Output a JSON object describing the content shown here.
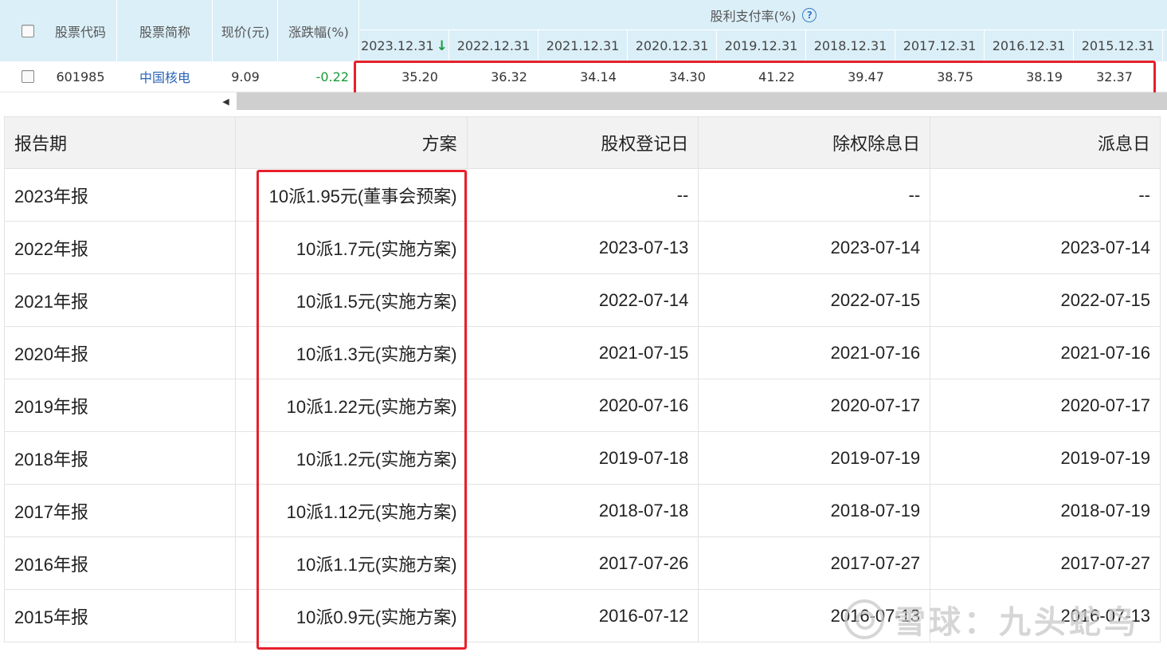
{
  "screener": {
    "headers": {
      "stock_code": "股票代码",
      "stock_name": "股票简称",
      "price": "现价(元)",
      "change_pct": "涨跌幅(%)",
      "payout_group": "股利支付率(%)"
    },
    "years": [
      "2023.12.31",
      "2022.12.31",
      "2021.12.31",
      "2020.12.31",
      "2019.12.31",
      "2018.12.31",
      "2017.12.31",
      "2016.12.31",
      "2015.12.31"
    ],
    "sort_indicator": "↓",
    "help_icon": "?",
    "row": {
      "code": "601985",
      "name": "中国核电",
      "price": "9.09",
      "change": "-0.22",
      "payout": [
        "35.20",
        "36.32",
        "34.14",
        "34.30",
        "41.22",
        "39.47",
        "38.75",
        "38.19",
        "32.37"
      ]
    },
    "scroll_left_icon": "◀",
    "colors": {
      "header_bg": "#dbeff8",
      "link": "#2b63b7",
      "negative": "#1a9a3a",
      "highlight": "#e8202a"
    }
  },
  "dividends": {
    "headers": {
      "period": "报告期",
      "plan": "方案",
      "record_date": "股权登记日",
      "ex_date": "除权除息日",
      "pay_date": "派息日"
    },
    "rows": [
      {
        "period": "2023年报",
        "plan": "10派1.95元(董事会预案)",
        "record": "--",
        "ex": "--",
        "pay": "--"
      },
      {
        "period": "2022年报",
        "plan": "10派1.7元(实施方案)",
        "record": "2023-07-13",
        "ex": "2023-07-14",
        "pay": "2023-07-14"
      },
      {
        "period": "2021年报",
        "plan": "10派1.5元(实施方案)",
        "record": "2022-07-14",
        "ex": "2022-07-15",
        "pay": "2022-07-15"
      },
      {
        "period": "2020年报",
        "plan": "10派1.3元(实施方案)",
        "record": "2021-07-15",
        "ex": "2021-07-16",
        "pay": "2021-07-16"
      },
      {
        "period": "2019年报",
        "plan": "10派1.22元(实施方案)",
        "record": "2020-07-16",
        "ex": "2020-07-17",
        "pay": "2020-07-17"
      },
      {
        "period": "2018年报",
        "plan": "10派1.2元(实施方案)",
        "record": "2019-07-18",
        "ex": "2019-07-19",
        "pay": "2019-07-19"
      },
      {
        "period": "2017年报",
        "plan": "10派1.12元(实施方案)",
        "record": "2018-07-18",
        "ex": "2018-07-19",
        "pay": "2018-07-19"
      },
      {
        "period": "2016年报",
        "plan": "10派1.1元(实施方案)",
        "record": "2017-07-26",
        "ex": "2017-07-27",
        "pay": "2017-07-27"
      },
      {
        "period": "2015年报",
        "plan": "10派0.9元(实施方案)",
        "record": "2016-07-12",
        "ex": "2016-07-13",
        "pay": "2016-07-13"
      }
    ]
  },
  "watermark": "雪球：九头蛇鸟"
}
